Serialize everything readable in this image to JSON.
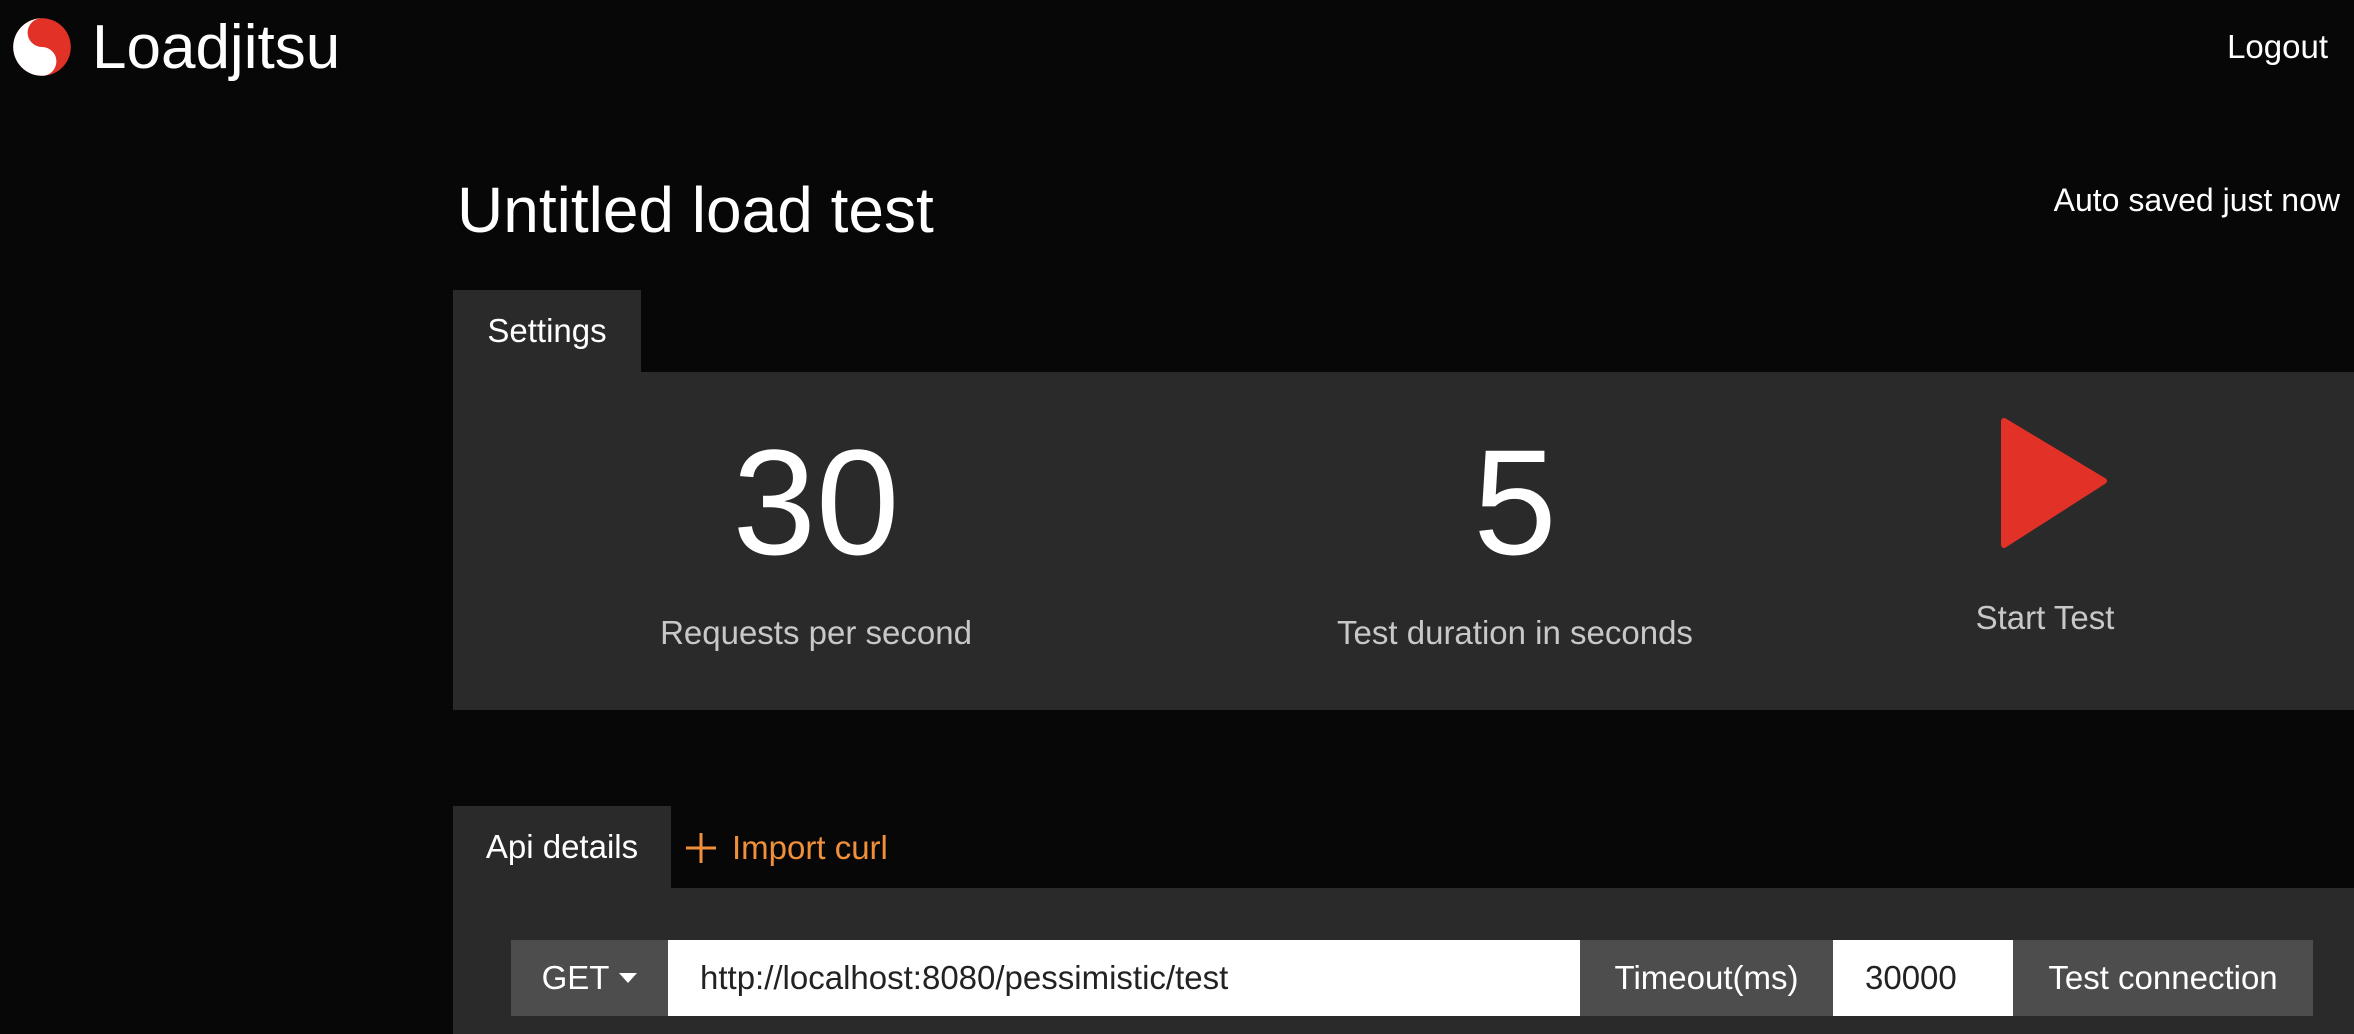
{
  "app": {
    "name": "Loadjitsu",
    "logout_label": "Logout",
    "logo_icon": "yin-yang-icon",
    "accent_color": "#e23127"
  },
  "page": {
    "title": "Untitled load test",
    "autosave_status": "Auto saved just now"
  },
  "settings": {
    "tab_label": "Settings",
    "requests_per_second": "30",
    "requests_per_second_label": "Requests per second",
    "duration_seconds": "5",
    "duration_label": "Test duration in seconds",
    "start_label": "Start Test",
    "start_icon": "play-icon"
  },
  "api": {
    "tab_label": "Api details",
    "import_curl_label": "Import curl",
    "import_icon": "plus-icon",
    "import_color": "#f0903a",
    "method": "GET",
    "url": "http://localhost:8080/pessimistic/test",
    "timeout_label": "Timeout(ms)",
    "timeout_value": "30000",
    "test_connection_label": "Test connection"
  }
}
